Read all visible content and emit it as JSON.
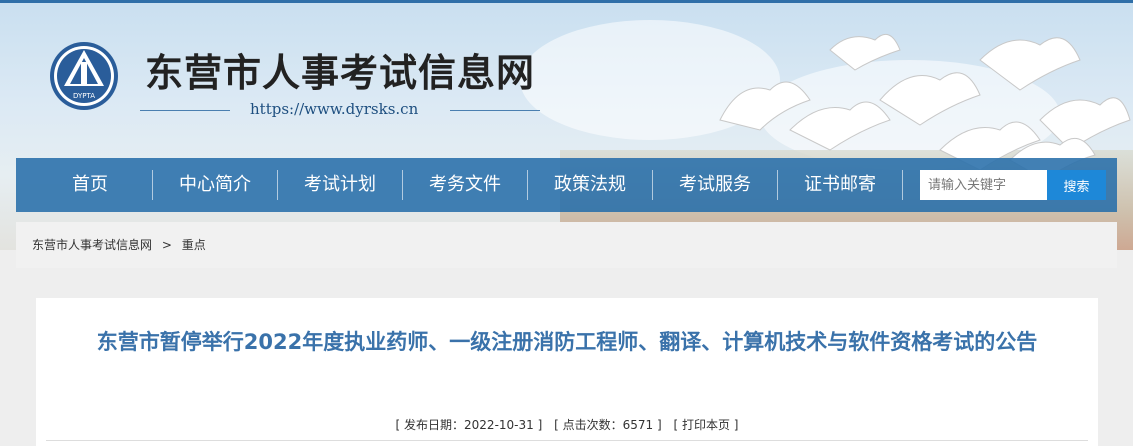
{
  "header": {
    "site_name": "东营市人事考试信息网",
    "site_url": "https://www.dyrsks.cn",
    "logo_text": "DYPTA"
  },
  "nav": {
    "items": [
      {
        "label": "首页"
      },
      {
        "label": "中心简介"
      },
      {
        "label": "考试计划"
      },
      {
        "label": "考务文件"
      },
      {
        "label": "政策法规"
      },
      {
        "label": "考试服务"
      },
      {
        "label": "证书邮寄"
      }
    ],
    "search_placeholder": "请输入关键字",
    "search_button": "搜索"
  },
  "breadcrumb": {
    "home": "东营市人事考试信息网",
    "separator": ">",
    "current": "重点"
  },
  "article": {
    "title": "东营市暂停举行2022年度执业药师、一级注册消防工程师、翻译、计算机技术与软件资格考试的公告",
    "publish_label": "[ 发布日期：2022-10-31 ]",
    "clicks_label": "[ 点击次数：6571 ]",
    "print_label": "[ 打印本页 ]"
  },
  "colors": {
    "nav_bg": "#286eaa",
    "title": "#3a72aa",
    "search_button": "#1e88d8"
  }
}
